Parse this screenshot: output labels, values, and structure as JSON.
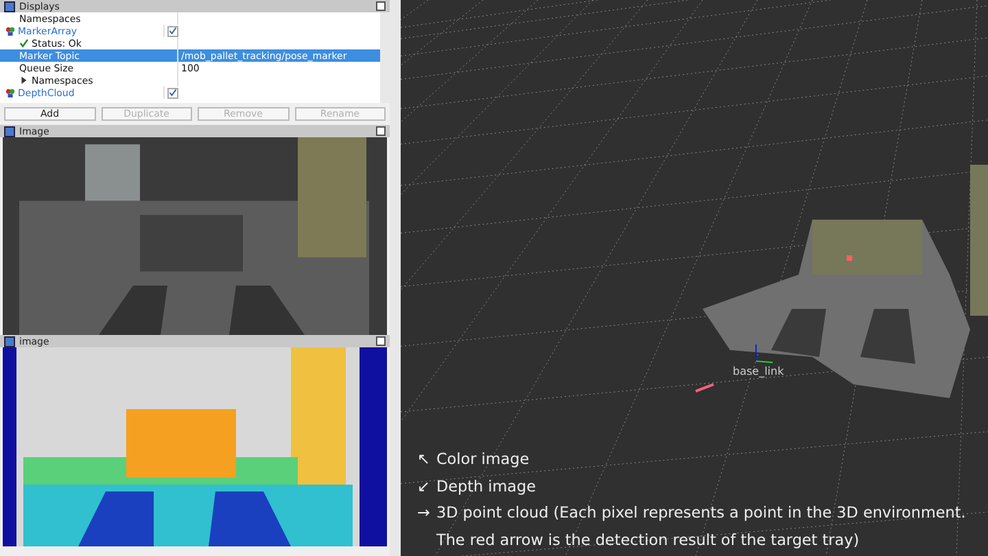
{
  "displays_panel": {
    "title": "Displays",
    "items": [
      {
        "kind": "property",
        "label": "Namespaces",
        "selected": false
      },
      {
        "kind": "display",
        "label": "MarkerArray",
        "checked": true,
        "selected": false,
        "children": [
          {
            "kind": "status",
            "label": "Status: Ok",
            "selected": false
          },
          {
            "kind": "property",
            "label": "Marker Topic",
            "value": "/mob_pallet_tracking/pose_marker",
            "selected": true
          },
          {
            "kind": "property",
            "label": "Queue Size",
            "value": "100",
            "selected": false
          },
          {
            "kind": "group",
            "label": "Namespaces",
            "expanded": false,
            "selected": false
          }
        ]
      },
      {
        "kind": "display",
        "label": "DepthCloud",
        "checked": true,
        "selected": false
      }
    ],
    "buttons": [
      {
        "label": "Add",
        "disabled": false
      },
      {
        "label": "Duplicate",
        "disabled": true
      },
      {
        "label": "Remove",
        "disabled": true
      },
      {
        "label": "Rename",
        "disabled": true
      }
    ]
  },
  "image_panels": [
    {
      "title": "Image",
      "kind": "color"
    },
    {
      "title": "image",
      "kind": "depth"
    }
  ],
  "view": {
    "frame_label": "base_link",
    "caption": [
      {
        "arrow": "↖",
        "text": "Color image"
      },
      {
        "arrow": "↙",
        "text": "Depth image"
      },
      {
        "arrow": "→",
        "text": "3D point cloud (Each pixel represents a point in the 3D environment."
      },
      {
        "text": "The red arrow is the detection result of the target tray)"
      }
    ]
  }
}
